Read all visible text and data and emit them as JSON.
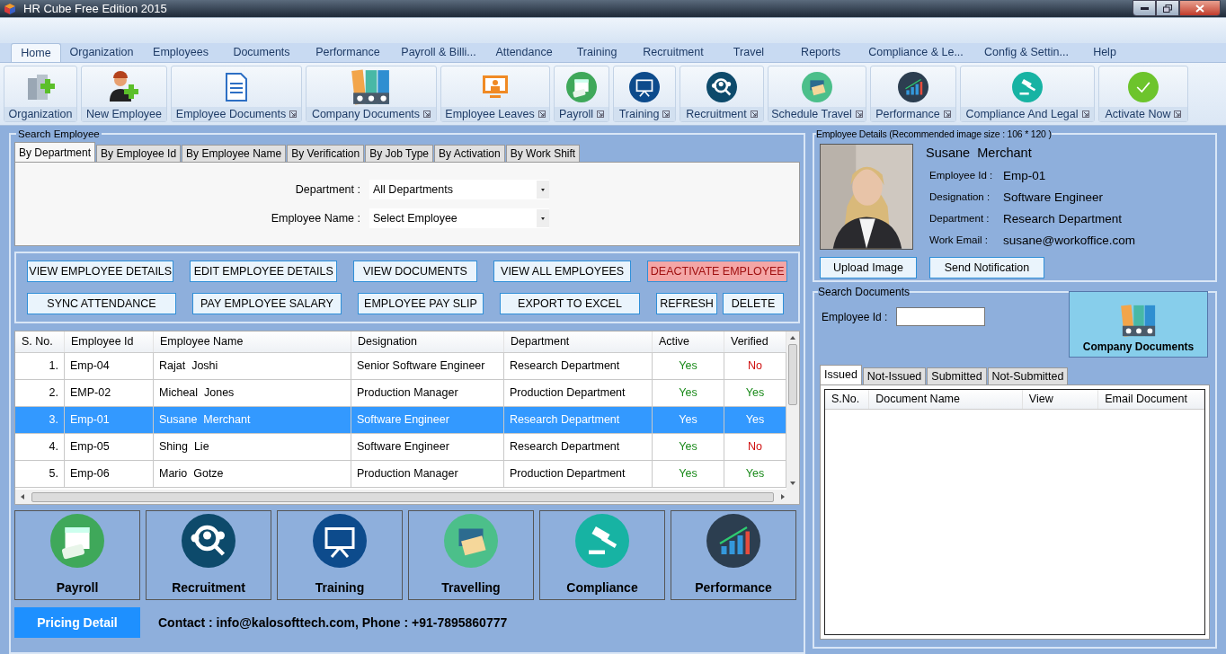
{
  "window": {
    "title": "HR Cube Free Edition 2015"
  },
  "menu_tabs": [
    {
      "label": "Home",
      "selected": true
    },
    {
      "label": "Organization",
      "selected": false
    },
    {
      "label": "Employees",
      "selected": false
    },
    {
      "label": "Documents",
      "selected": false
    },
    {
      "label": "Performance",
      "selected": false
    },
    {
      "label": "Payroll & Billi...",
      "selected": false
    },
    {
      "label": "Attendance",
      "selected": false
    },
    {
      "label": "Training",
      "selected": false
    },
    {
      "label": "Recruitment",
      "selected": false
    },
    {
      "label": "Travel",
      "selected": false
    },
    {
      "label": "Reports",
      "selected": false
    },
    {
      "label": "Compliance & Le...",
      "selected": false
    },
    {
      "label": "Config & Settin...",
      "selected": false
    },
    {
      "label": "Help",
      "selected": false
    }
  ],
  "ribbon": [
    {
      "label": "Organization",
      "launcher": false
    },
    {
      "label": "New Employee",
      "launcher": false
    },
    {
      "label": "Employee Documents",
      "launcher": true
    },
    {
      "label": "Company Documents",
      "launcher": true
    },
    {
      "label": "Employee Leaves",
      "launcher": true
    },
    {
      "label": "Payroll",
      "launcher": true
    },
    {
      "label": "Training",
      "launcher": true
    },
    {
      "label": "Recruitment",
      "launcher": true
    },
    {
      "label": "Schedule Travel",
      "launcher": true
    },
    {
      "label": "Performance",
      "launcher": true
    },
    {
      "label": "Compliance And Legal",
      "launcher": true
    },
    {
      "label": "Activate Now",
      "launcher": true
    }
  ],
  "search_employee": {
    "title": "Search Employee",
    "tabs": [
      {
        "label": "By Department",
        "selected": true
      },
      {
        "label": "By Employee Id",
        "selected": false
      },
      {
        "label": "By Employee Name",
        "selected": false
      },
      {
        "label": "By Verification",
        "selected": false
      },
      {
        "label": "By Job Type",
        "selected": false
      },
      {
        "label": "By Activation",
        "selected": false
      },
      {
        "label": "By Work Shift",
        "selected": false
      }
    ],
    "fields": [
      {
        "label": "Department :",
        "value": "All Departments"
      },
      {
        "label": "Employee Name :",
        "value": "Select Employee"
      }
    ]
  },
  "actions": [
    [
      {
        "label": "VIEW EMPLOYEE DETAILS",
        "danger": false
      },
      {
        "label": "EDIT EMPLOYEE DETAILS",
        "danger": false
      },
      {
        "label": "VIEW DOCUMENTS",
        "danger": false
      },
      {
        "label": "VIEW ALL EMPLOYEES",
        "danger": false
      },
      {
        "label": "DEACTIVATE EMPLOYEE",
        "danger": true
      }
    ],
    [
      {
        "label": "SYNC ATTENDANCE",
        "danger": false
      },
      {
        "label": "PAY EMPLOYEE SALARY",
        "danger": false
      },
      {
        "label": "EMPLOYEE PAY SLIP",
        "danger": false
      },
      {
        "label": "EXPORT TO EXCEL",
        "danger": false
      },
      {
        "label": "REFRESH",
        "danger": false
      },
      {
        "label": "DELETE",
        "danger": false
      }
    ]
  ],
  "table": {
    "columns": [
      "S. No.",
      "Employee Id",
      "Employee Name",
      "Designation",
      "Department",
      "Active",
      "Verified"
    ],
    "rows": [
      {
        "selected": false,
        "cells": [
          "1.",
          "Emp-04",
          "Rajat  Joshi",
          "Senior Software Engineer",
          "Research Department"
        ],
        "active": {
          "text": "Yes",
          "ok": true
        },
        "verified": {
          "text": "No",
          "ok": false
        }
      },
      {
        "selected": false,
        "cells": [
          "2.",
          "EMP-02",
          "Micheal  Jones",
          "Production Manager",
          "Production Department"
        ],
        "active": {
          "text": "Yes",
          "ok": true
        },
        "verified": {
          "text": "Yes",
          "ok": true
        }
      },
      {
        "selected": true,
        "cells": [
          "3.",
          "Emp-01",
          "Susane  Merchant",
          "Software Engineer",
          "Research Department"
        ],
        "active": {
          "text": "Yes",
          "ok": true
        },
        "verified": {
          "text": "Yes",
          "ok": true
        }
      },
      {
        "selected": false,
        "cells": [
          "4.",
          "Emp-05",
          "Shing  Lie",
          "Software Engineer",
          "Research Department"
        ],
        "active": {
          "text": "Yes",
          "ok": true
        },
        "verified": {
          "text": "No",
          "ok": false
        }
      },
      {
        "selected": false,
        "cells": [
          "5.",
          "Emp-06",
          "Mario  Gotze",
          "Production Manager",
          "Production Department"
        ],
        "active": {
          "text": "Yes",
          "ok": true
        },
        "verified": {
          "text": "Yes",
          "ok": true
        }
      }
    ]
  },
  "tiles": [
    "Payroll",
    "Recruitment",
    "Training",
    "Travelling",
    "Compliance",
    "Performance"
  ],
  "footer": {
    "button": "Pricing Detail",
    "contact": "Contact : info@kalosofttech.com, Phone : +91-7895860777"
  },
  "employee_details": {
    "title": "Employee Details (Recommended image size : 106 * 120 )",
    "name": "Susane  Merchant",
    "fields": [
      {
        "label": "Employee Id :",
        "value": "Emp-01"
      },
      {
        "label": "Designation :",
        "value": "Software Engineer"
      },
      {
        "label": "Department :",
        "value": "Research Department"
      },
      {
        "label": "Work Email :",
        "value": "susane@workoffice.com"
      }
    ],
    "buttons": [
      "Upload Image",
      "Send Notification"
    ]
  },
  "search_documents": {
    "title": "Search Documents",
    "field_label": "Employee Id :",
    "company_button": "Company Documents",
    "tabs": [
      {
        "label": "Issued",
        "selected": true
      },
      {
        "label": "Not-Issued",
        "selected": false
      },
      {
        "label": "Submitted",
        "selected": false
      },
      {
        "label": "Not-Submitted",
        "selected": false
      }
    ],
    "columns": [
      "S.No.",
      "Document Name",
      "View",
      "Email Document"
    ]
  }
}
